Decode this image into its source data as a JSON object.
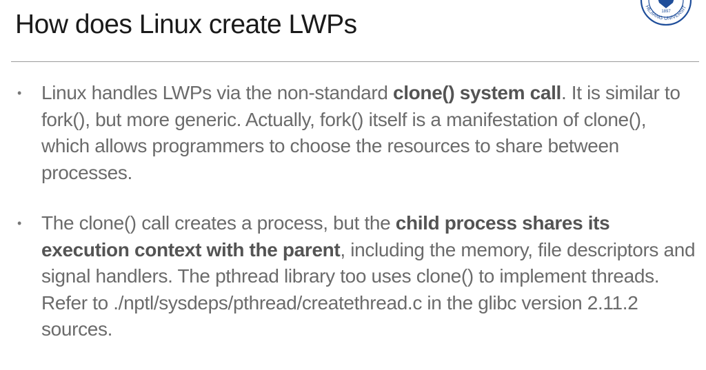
{
  "slide": {
    "title": "How does Linux create LWPs"
  },
  "logo": {
    "icon": "zhejiang-university-seal-icon",
    "text": "ZHEJIANG UNIVERSITY",
    "year": "1897"
  },
  "bullets": [
    {
      "segments": [
        {
          "text": "Linux handles LWPs via the non-standard ",
          "bold": false
        },
        {
          "text": "clone() system call",
          "bold": true
        },
        {
          "text": ". It is similar to fork(), but more generic. Actually, fork() itself is a manifestation of clone(), which allows programmers to choose the resources to share between processes.",
          "bold": false
        }
      ]
    },
    {
      "segments": [
        {
          "text": "The clone() call creates a process, but the ",
          "bold": false
        },
        {
          "text": "child process shares its execution context with the parent",
          "bold": true
        },
        {
          "text": ", including the memory, file descriptors and signal handlers. The pthread library too uses clone() to implement threads. Refer to ./nptl/sysdeps/pthread/createthread.c in the glibc version 2.11.2 sources.",
          "bold": false
        }
      ]
    }
  ],
  "colors": {
    "title": "#1a1a1a",
    "body_text": "#6b6b6b",
    "bold_text": "#545454",
    "rule": "#9a9a9a",
    "logo_blue": "#1f4e9a"
  }
}
